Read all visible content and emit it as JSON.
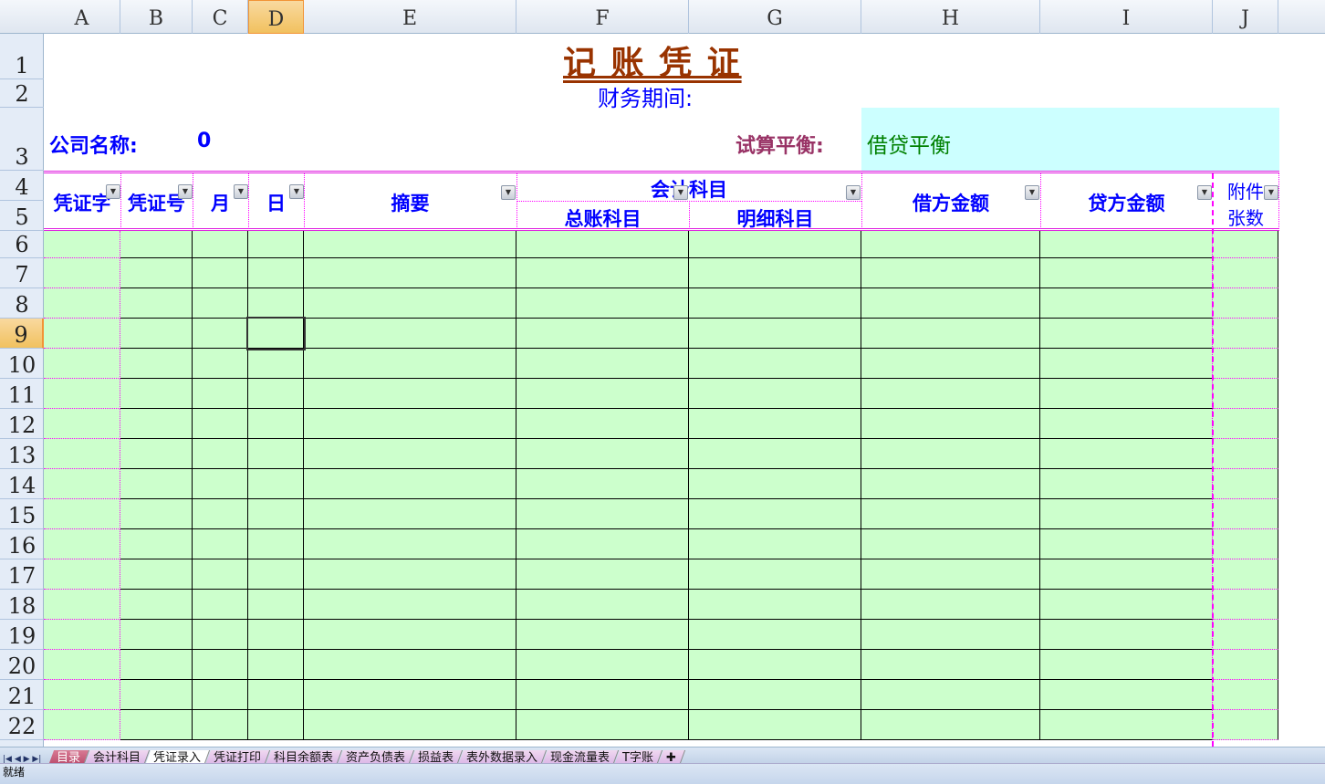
{
  "columns": [
    "A",
    "B",
    "C",
    "D",
    "E",
    "F",
    "G",
    "H",
    "I",
    "J"
  ],
  "selected_column": "D",
  "selected_row": "9",
  "rows": [
    "1",
    "2",
    "3",
    "4",
    "5",
    "6",
    "7",
    "8",
    "9",
    "10",
    "11",
    "12",
    "13",
    "14",
    "15",
    "16",
    "17",
    "18",
    "19",
    "20",
    "21",
    "22"
  ],
  "sheet": {
    "title": "记 账 凭 证",
    "period_label": "财务期间:",
    "company_label": "公司名称:",
    "company_value": "0",
    "balance_label": "试算平衡:",
    "balance_value": "借贷平衡",
    "headers": {
      "a": "凭证字",
      "b": "凭证号",
      "c": "月",
      "d": "日",
      "e": "摘要",
      "fg": "会计科目",
      "f": "总账科目",
      "g": "明细科目",
      "h": "借方金额",
      "i": "贷方金额",
      "j1": "附件",
      "j2": "张数"
    }
  },
  "colors": {
    "title": "#993300",
    "label": "#0000ff",
    "balance_label": "#993366",
    "balance_value": "#008000",
    "cell_fill": "#ccffcc",
    "balance_fill": "#ccffff"
  },
  "tabs": [
    "目录",
    "会计科目",
    "凭证录入",
    "凭证打印",
    "科目余额表",
    "资产负债表",
    "损益表",
    "表外数据录入",
    "现金流量表",
    "T字账"
  ],
  "active_tab": "凭证录入",
  "status": "就绪"
}
